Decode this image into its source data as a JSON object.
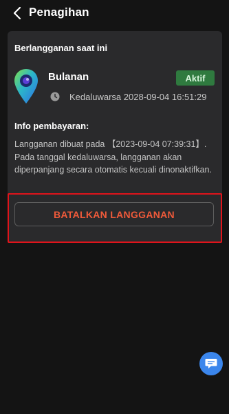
{
  "header": {
    "title": "Penagihan",
    "back_icon": "chevron-left-icon"
  },
  "subscription": {
    "heading": "Berlangganan saat ini",
    "plan_name": "Bulanan",
    "status": "Aktif",
    "expiry": "Kedaluwarsa 2028-09-04 16:51:29",
    "app_icon": "map-pin-globe-icon",
    "clock_icon": "clock-icon"
  },
  "payment": {
    "heading": "Info pembayaran:",
    "text": "Langganan dibuat pada 【2023-09-04 07:39:31】. Pada tanggal kedaluwarsa, langganan akan diperpanjang secara otomatis kecuali dinonaktifkan."
  },
  "actions": {
    "cancel_label": "BATALKAN LANGGANAN"
  },
  "support": {
    "chat_icon": "chat-bubble-icon"
  },
  "colors": {
    "background": "#141414",
    "card": "#2a2a2c",
    "status_badge": "#2f7a3f",
    "cancel_text": "#f05a3a",
    "highlight_border": "#e0141b",
    "chat_button": "#3b86ec"
  }
}
